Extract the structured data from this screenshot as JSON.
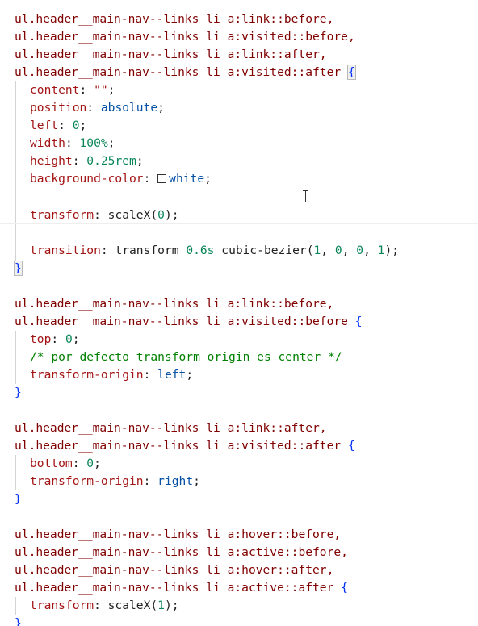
{
  "code": {
    "block1": {
      "sel1": "ul.header__main-nav--links li a:link::before,",
      "sel2": "ul.header__main-nav--links li a:visited::before,",
      "sel3": "ul.header__main-nav--links li a:link::after,",
      "sel4": "ul.header__main-nav--links li a:visited::after ",
      "open": "{",
      "content_prop": "content",
      "content_val": "\"\"",
      "position_prop": "position",
      "position_val": "absolute",
      "left_prop": "left",
      "left_val": "0",
      "width_prop": "width",
      "width_val": "100%",
      "height_prop": "height",
      "height_val": "0.25rem",
      "bg_prop": "background-color",
      "bg_val": "white",
      "transform_prop": "transform",
      "transform_fn": "scaleX(",
      "transform_arg": "0",
      "transform_close": ")",
      "transition_prop": "transition",
      "transition_word": "transform",
      "transition_dur": "0.6s",
      "transition_fn": "cubic-bezier(",
      "transition_a": "1",
      "transition_b": "0",
      "transition_c": "0",
      "transition_d": "1",
      "close": "}"
    },
    "block2": {
      "sel1": "ul.header__main-nav--links li a:link::before,",
      "sel2": "ul.header__main-nav--links li a:visited::before ",
      "open": "{",
      "top_prop": "top",
      "top_val": "0",
      "comment": "/* por defecto transform origin es center */",
      "origin_prop": "transform-origin",
      "origin_val": "left",
      "close": "}"
    },
    "block3": {
      "sel1": "ul.header__main-nav--links li a:link::after,",
      "sel2": "ul.header__main-nav--links li a:visited::after ",
      "open": "{",
      "bottom_prop": "bottom",
      "bottom_val": "0",
      "origin_prop": "transform-origin",
      "origin_val": "right",
      "close": "}"
    },
    "block4": {
      "sel1": "ul.header__main-nav--links li a:hover::before,",
      "sel2": "ul.header__main-nav--links li a:active::before,",
      "sel3": "ul.header__main-nav--links li a:hover::after,",
      "sel4": "ul.header__main-nav--links li a:active::after ",
      "open": "{",
      "transform_prop": "transform",
      "transform_fn": "scaleX(",
      "transform_arg": "1",
      "transform_close": ")",
      "close": "}"
    }
  },
  "colors": {
    "selector": "#800000",
    "property": "#a31515",
    "value": "#0451a5",
    "number": "#098658",
    "comment": "#008000",
    "brace": "#0431fa"
  },
  "icons": {
    "color_swatch": "color-swatch-icon",
    "text_cursor": "text-cursor-icon"
  }
}
